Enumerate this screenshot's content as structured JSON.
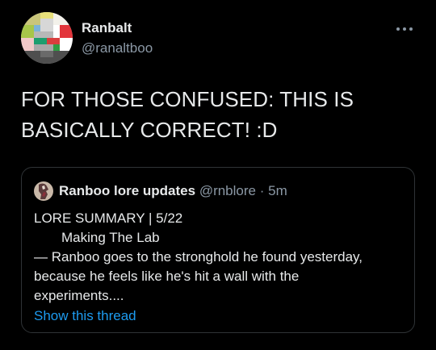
{
  "author": {
    "name": "Ranbalt",
    "handle": "@ranaltboo",
    "avatar_icon": "pixel-avatar-icon"
  },
  "more_icon": "more-horizontal-icon",
  "tweet": {
    "lines": [
      "FOR THOSE CONFUSED: THIS IS",
      "BASICALLY CORRECT! :D"
    ]
  },
  "quoted": {
    "name": "Ranboo lore updates",
    "handle": "@rnblore",
    "separator": "·",
    "time": "5m",
    "avatar_icon": "quoted-avatar-icon",
    "body_lines": [
      "LORE SUMMARY | 5/22",
      "Making The Lab",
      "— Ranboo goes to the stronghold he found yesterday,",
      "because he feels like he's hit a wall with the",
      "experiments...."
    ],
    "show_thread": "Show this thread"
  },
  "colors": {
    "background": "#000000",
    "text": "#e7e9ea",
    "secondary": "#8b98a5",
    "link": "#1d9bf0",
    "border": "#2f3336"
  }
}
